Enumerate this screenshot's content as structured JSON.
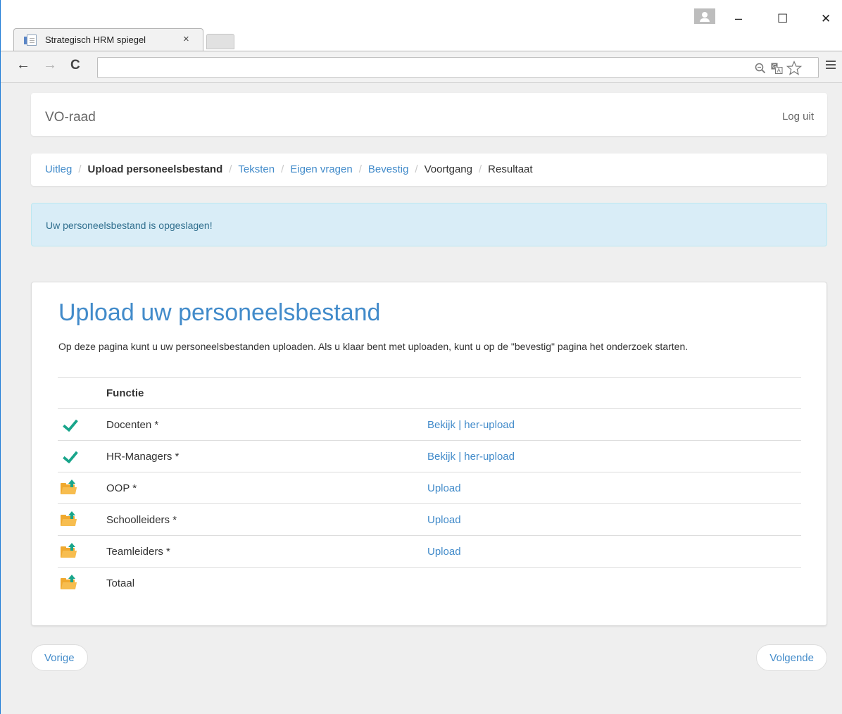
{
  "browser": {
    "tab_title": "Strategisch HRM spiegel",
    "tab_close": "×",
    "window_controls": {
      "minimize": "–",
      "maximize": "☐",
      "close": "✕"
    },
    "nav": {
      "back": "←",
      "forward": "→",
      "reload": "C"
    },
    "address": "",
    "omnibox_icons": [
      "zoom-icon",
      "translate-icon",
      "bookmark-star-icon"
    ]
  },
  "header": {
    "brand": "VO-raad",
    "logout": "Log uit"
  },
  "breadcrumb": {
    "items": [
      {
        "label": "Uitleg",
        "state": "link"
      },
      {
        "label": "Upload personeelsbestand",
        "state": "active"
      },
      {
        "label": "Teksten",
        "state": "link"
      },
      {
        "label": "Eigen vragen",
        "state": "link"
      },
      {
        "label": "Bevestig",
        "state": "link"
      },
      {
        "label": "Voortgang",
        "state": "plain"
      },
      {
        "label": "Resultaat",
        "state": "plain"
      }
    ],
    "separator": "/"
  },
  "alert": {
    "message": "Uw personeelsbestand is opgeslagen!"
  },
  "main": {
    "title": "Upload uw personeelsbestand",
    "intro": "Op deze pagina kunt u uw personeelsbestanden uploaden. Als u klaar bent met uploaden, kunt u op de \"bevestig\" pagina het onderzoek starten.",
    "table": {
      "header": {
        "function": "Functie"
      },
      "rows": [
        {
          "status": "uploaded",
          "function": "Docenten *",
          "view": "Bekijk",
          "sep": "|",
          "reupload": "her-upload"
        },
        {
          "status": "uploaded",
          "function": "HR-Managers *",
          "view": "Bekijk",
          "sep": "|",
          "reupload": "her-upload"
        },
        {
          "status": "pending",
          "function": "OOP *",
          "upload": "Upload"
        },
        {
          "status": "pending",
          "function": "Schoolleiders *",
          "upload": "Upload"
        },
        {
          "status": "pending",
          "function": "Teamleiders *",
          "upload": "Upload"
        },
        {
          "status": "pending",
          "function": "Totaal"
        }
      ]
    }
  },
  "footer": {
    "previous": "Vorige",
    "next": "Volgende"
  },
  "colors": {
    "link": "#428bca",
    "check": "#19a58b",
    "folder": "#f0a92e",
    "alert_bg": "#d9edf7",
    "alert_text": "#31708f"
  }
}
